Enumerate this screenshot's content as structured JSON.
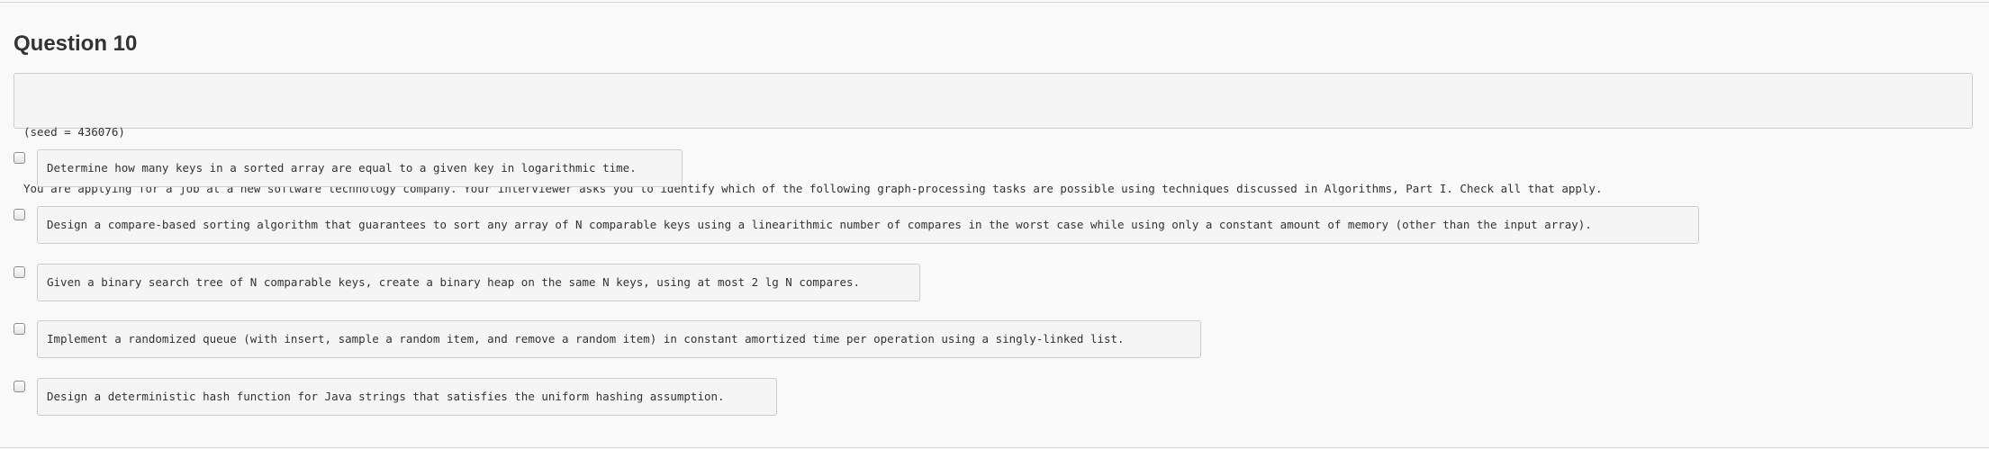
{
  "question": {
    "title": "Question 10",
    "seed_line": "(seed = 436076)",
    "prompt": "You are applying for a job at a new software technology company. Your interviewer asks you to identify which of the following graph-processing tasks are possible using techniques discussed in Algorithms, Part I. Check all that apply."
  },
  "options": [
    {
      "text": "Determine how many keys in a sorted array are equal to a given key in logarithmic time.",
      "checked": false
    },
    {
      "text": "Design a compare-based sorting algorithm that guarantees to sort any array of N comparable keys using a linearithmic number of compares in the worst case while using only a constant amount of memory (other than the input array).",
      "checked": false
    },
    {
      "text": "Given a binary search tree of N comparable keys, create a binary heap on the same N keys, using at most 2 lg N compares.",
      "checked": false
    },
    {
      "text": "Implement a randomized queue (with insert, sample a random item, and remove a random item) in constant amortized time per operation using a singly-linked list.",
      "checked": false
    },
    {
      "text": "Design a deterministic hash function for Java strings that satisfies the uniform hashing assumption.",
      "checked": false
    }
  ]
}
